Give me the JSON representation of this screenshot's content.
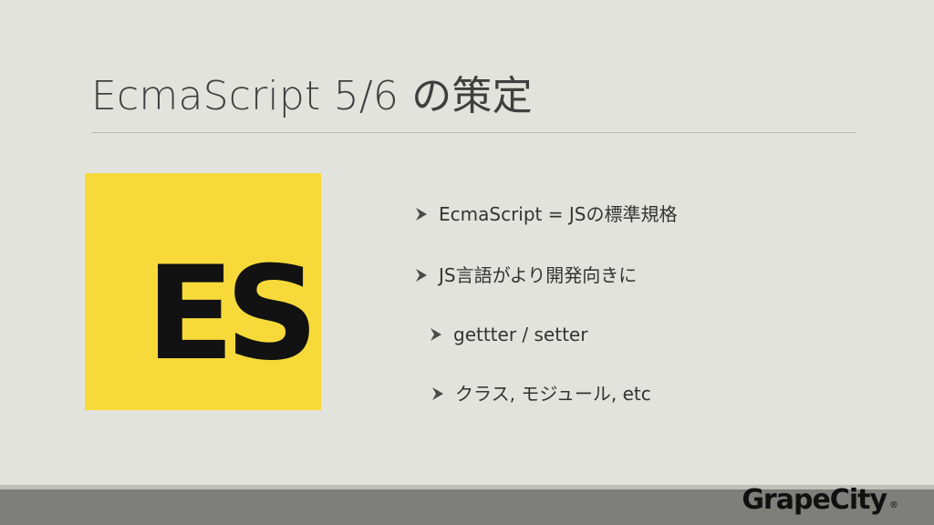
{
  "slide": {
    "title": "EcmaScript 5/6 の策定",
    "logo": {
      "text": "ES",
      "background": "#f7da3a",
      "foreground": "#121212"
    },
    "bullets": [
      {
        "text": "EcmaScript = JSの標準規格",
        "icon": "arrow-bullet-icon"
      },
      {
        "text": "JS言語がより開発向きに",
        "icon": "arrow-bullet-icon"
      },
      {
        "text": "gettter / setter",
        "icon": "arrow-bullet-icon"
      },
      {
        "text": "クラス, モジュール, etc",
        "icon": "arrow-bullet-icon"
      }
    ],
    "brand": {
      "name": "GrapeCity",
      "mark": "®"
    }
  }
}
